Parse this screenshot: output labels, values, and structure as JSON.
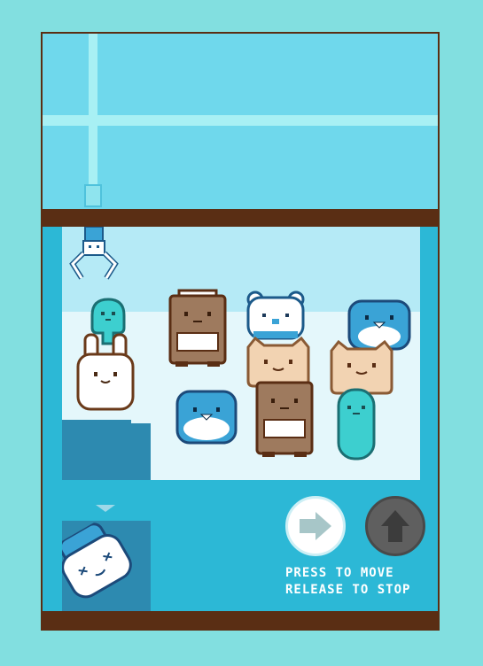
{
  "hint": {
    "line1": "PRESS TO MOVE",
    "line2": "RELEASE TO STOP"
  },
  "controls": {
    "move_icon": "right-arrow-icon",
    "up_icon": "up-arrow-icon"
  },
  "colors": {
    "wood": "#5a2e14",
    "machine": "#2cb8d6",
    "glass": "#6fd8ec",
    "button_active": "#ffffff",
    "button_disabled": "#5f5f5f"
  },
  "prizes": [
    {
      "name": "teal-slime"
    },
    {
      "name": "white-bunny"
    },
    {
      "name": "brown-robot"
    },
    {
      "name": "white-bear"
    },
    {
      "name": "blue-penguin"
    },
    {
      "name": "tan-cat"
    },
    {
      "name": "blue-penguin"
    },
    {
      "name": "brown-robot"
    },
    {
      "name": "teal-slime"
    }
  ],
  "won_prize": {
    "name": "white-blue-bear"
  }
}
